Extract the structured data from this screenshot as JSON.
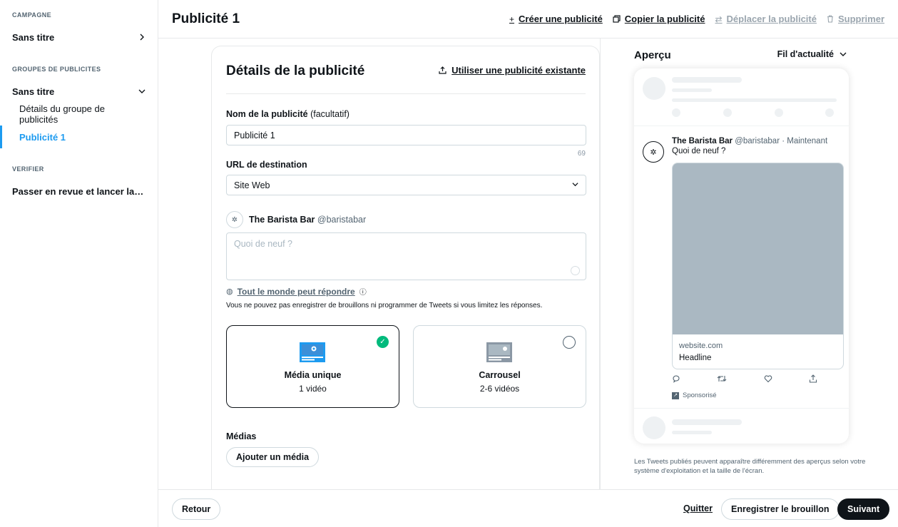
{
  "sidebar": {
    "campaign_section": "CAMPAGNE",
    "campaign_item": "Sans titre",
    "adgroups_section": "GROUPES DE PUBLICITES",
    "adgroup_item": "Sans titre",
    "adgroup_details": "Détails du groupe de publicités",
    "ad_item": "Publicité 1",
    "verify_section": "VERIFIER",
    "review_item": "Passer en revue et lancer la campagne"
  },
  "header": {
    "title": "Publicité 1",
    "create": "Créer une publicité",
    "copy": "Copier la publicité",
    "move": "Déplacer la publicité",
    "delete": "Supprimer"
  },
  "form": {
    "title": "Détails de la publicité",
    "use_existing": "Utiliser une publicité existante",
    "name_label": "Nom de la publicité",
    "name_optional": "(facultatif)",
    "name_value": "Publicité 1",
    "name_counter": "69",
    "url_label": "URL de destination",
    "url_value": "Site Web",
    "account_name": "The Barista Bar",
    "account_handle": "@baristabar",
    "tweet_placeholder": "Quoi de neuf ?",
    "reply_setting": "Tout le monde peut répondre",
    "reply_hint": "Vous ne pouvez pas enregistrer de brouillons ni programmer de Tweets si vous limitez les réponses.",
    "options": [
      {
        "title": "Média unique",
        "sub": "1 vidéo",
        "selected": true
      },
      {
        "title": "Carrousel",
        "sub": "2-6 vidéos",
        "selected": false
      }
    ],
    "media_label": "Médias",
    "add_media": "Ajouter un média"
  },
  "preview": {
    "title": "Aperçu",
    "placement": "Fil d'actualité",
    "tweet_name": "The Barista Bar",
    "tweet_handle": "@baristabar",
    "tweet_time": "· Maintenant",
    "tweet_text": "Quoi de neuf ?",
    "card_domain": "website.com",
    "card_headline": "Headline",
    "promoted": "Sponsorisé",
    "note": "Les Tweets publiés peuvent apparaître différemment des aperçus selon votre système d'exploitation et la taille de l'écran."
  },
  "footer": {
    "back": "Retour",
    "quit": "Quitter",
    "save_draft": "Enregistrer le brouillon",
    "next": "Suivant"
  },
  "colors": {
    "accent": "#1d9bf0",
    "success": "#00ba7c",
    "text": "#0f1419"
  }
}
